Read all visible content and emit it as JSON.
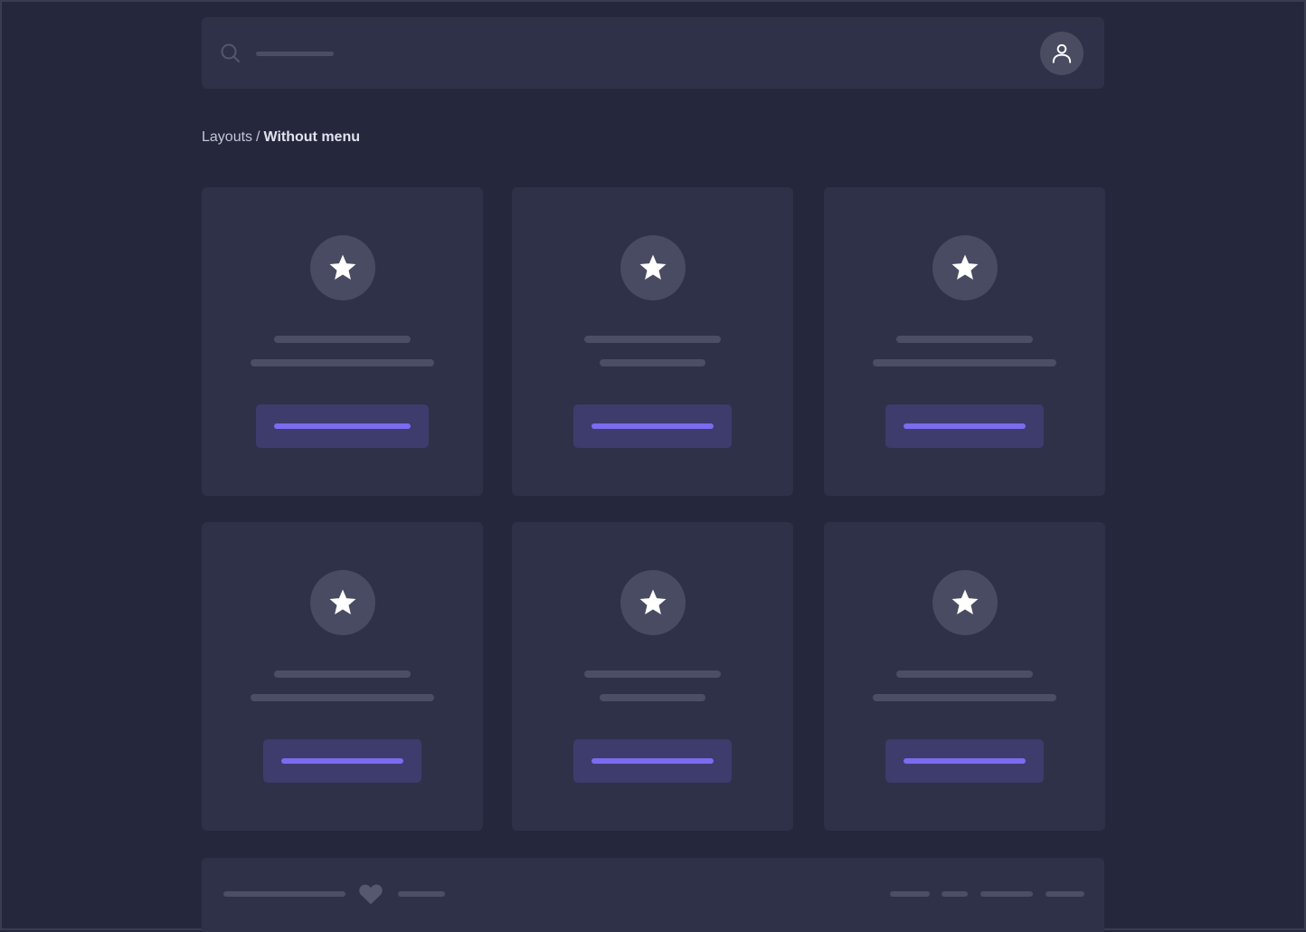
{
  "breadcrumb": {
    "parent": "Layouts",
    "separator": "/",
    "current": "Without menu"
  },
  "header": {
    "search_icon": "search-icon",
    "avatar_icon": "user-icon"
  },
  "cards": [
    {
      "icon": "star-icon"
    },
    {
      "icon": "star-icon"
    },
    {
      "icon": "star-icon"
    },
    {
      "icon": "star-icon"
    },
    {
      "icon": "star-icon"
    },
    {
      "icon": "star-icon"
    }
  ],
  "footer": {
    "icon": "heart-icon"
  },
  "colors": {
    "background": "#25283c",
    "surface": "#2e3148",
    "accent": "#7a6cf0",
    "button": "#3d3c6c"
  }
}
